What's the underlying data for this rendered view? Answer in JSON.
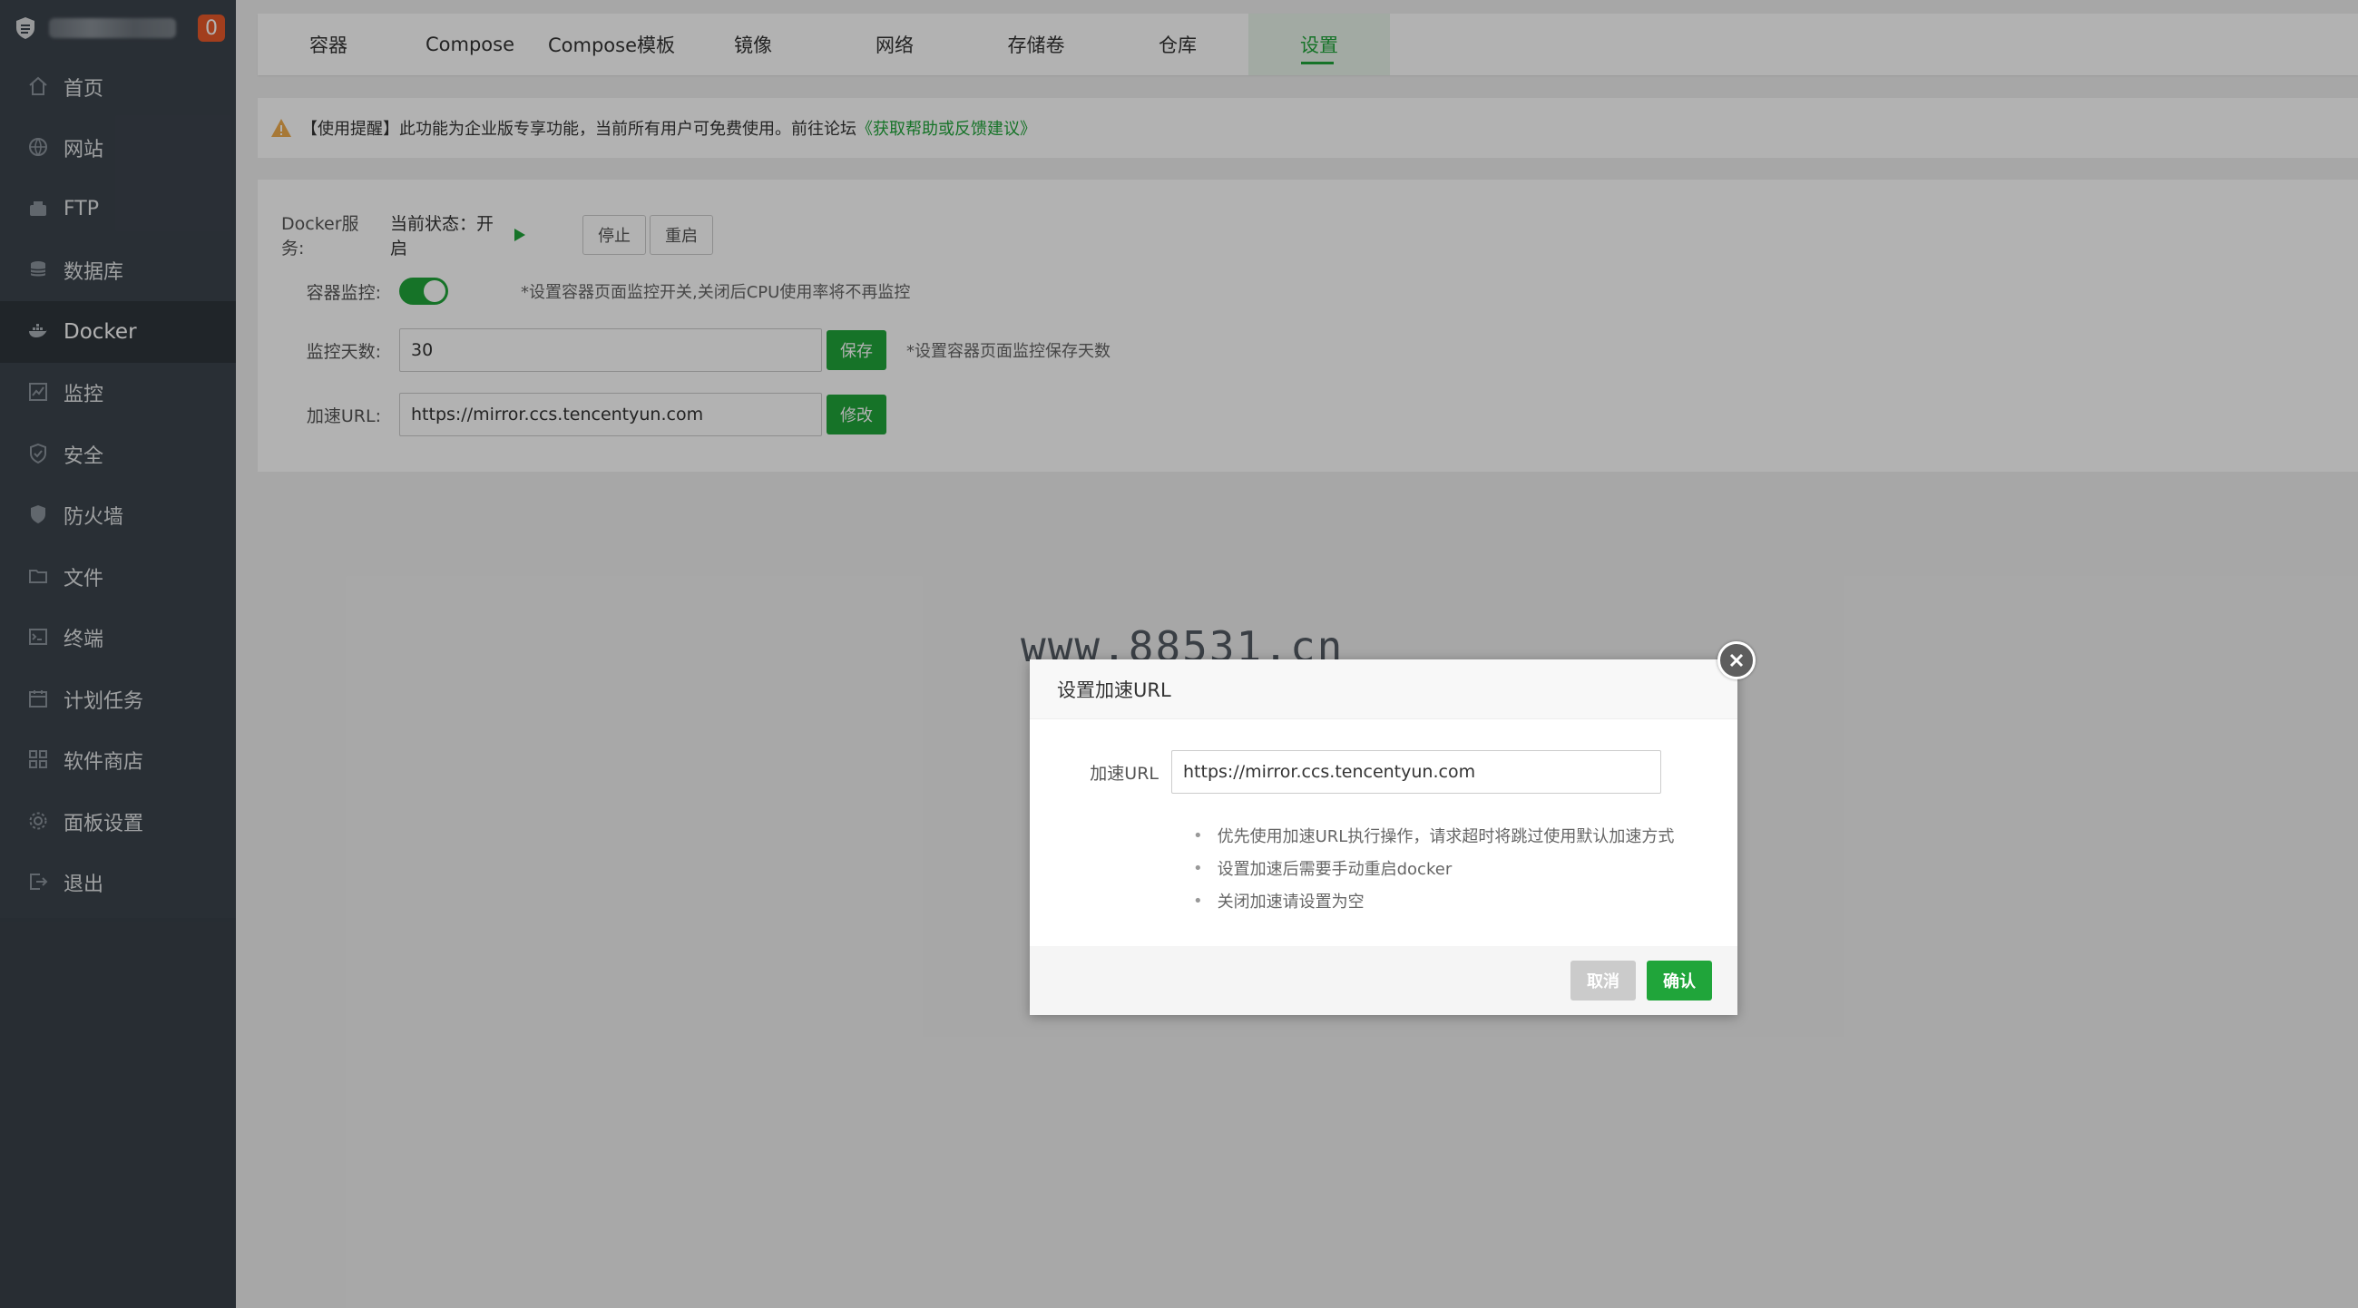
{
  "sidebar": {
    "badge": "0",
    "items": [
      {
        "label": "首页",
        "icon": "home-icon"
      },
      {
        "label": "网站",
        "icon": "globe-icon"
      },
      {
        "label": "FTP",
        "icon": "ftp-icon"
      },
      {
        "label": "数据库",
        "icon": "database-icon"
      },
      {
        "label": "Docker",
        "icon": "docker-icon",
        "active": true
      },
      {
        "label": "监控",
        "icon": "monitor-icon"
      },
      {
        "label": "安全",
        "icon": "shield-check-icon"
      },
      {
        "label": "防火墙",
        "icon": "firewall-icon"
      },
      {
        "label": "文件",
        "icon": "folder-icon"
      },
      {
        "label": "终端",
        "icon": "terminal-icon"
      },
      {
        "label": "计划任务",
        "icon": "calendar-icon"
      },
      {
        "label": "软件商店",
        "icon": "grid-icon"
      },
      {
        "label": "面板设置",
        "icon": "gear-icon"
      },
      {
        "label": "退出",
        "icon": "logout-icon"
      }
    ]
  },
  "tabs": [
    "容器",
    "Compose",
    "Compose模板",
    "镜像",
    "网络",
    "存储卷",
    "仓库",
    "设置"
  ],
  "active_tab": "设置",
  "notice": {
    "text": "【使用提醒】此功能为企业版专享功能，当前所有用户可免费使用。前往论坛",
    "link": "《获取帮助或反馈建议》"
  },
  "settings": {
    "docker_service_label": "Docker服务:",
    "status_text": "当前状态：开启",
    "stop_label": "停止",
    "restart_label": "重启",
    "monitor_label": "容器监控:",
    "monitor_hint": "*设置容器页面监控开关,关闭后CPU使用率将不再监控",
    "days_label": "监控天数:",
    "days_value": "30",
    "save_label": "保存",
    "days_hint": "*设置容器页面监控保存天数",
    "url_label": "加速URL:",
    "url_value": "https://mirror.ccs.tencentyun.com",
    "modify_label": "修改"
  },
  "watermark": "www.88531.cn",
  "dialog": {
    "title": "设置加速URL",
    "field_label": "加速URL",
    "field_value": "https://mirror.ccs.tencentyun.com",
    "tips": [
      "优先使用加速URL执行操作，请求超时将跳过使用默认加速方式",
      "设置加速后需要手动重启docker",
      "关闭加速请设置为空"
    ],
    "cancel_label": "取消",
    "confirm_label": "确认"
  },
  "colors": {
    "accent": "#20a53a",
    "sidebar": "#3c444d",
    "badge": "#e8592a"
  }
}
